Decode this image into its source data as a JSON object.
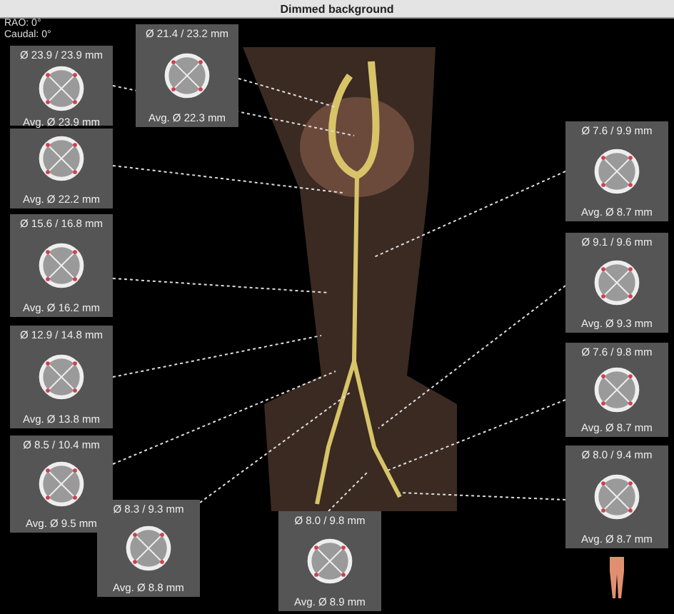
{
  "window": {
    "title": "Dimmed background"
  },
  "orientation": [
    "RAO: 0°",
    "Caudal: 0°"
  ],
  "panels": [
    {
      "diameters": "Ø 23.9 / 23.9 mm",
      "average": "Avg. Ø 23.9 mm"
    },
    {
      "average": "Avg. Ø 22.2 mm"
    },
    {
      "diameters": "Ø 15.6 / 16.8 mm",
      "average": "Avg. Ø 16.2 mm"
    },
    {
      "diameters": "Ø 12.9 / 14.8 mm",
      "average": "Avg. Ø 13.8 mm"
    },
    {
      "diameters": "Ø 8.5 / 10.4 mm",
      "average": "Avg. Ø 9.5 mm"
    },
    {
      "diameters": "Ø 8.3 / 9.3 mm",
      "average": "Avg. Ø 8.8 mm"
    },
    {
      "diameters": "Ø 21.4 / 23.2 mm",
      "average": "Avg. Ø 22.3 mm"
    },
    {
      "diameters": "Ø 8.0 / 9.8 mm",
      "average": "Avg. Ø 8.9 mm"
    },
    {
      "diameters": "Ø 7.6 / 9.9 mm",
      "average": "Avg. Ø 8.7 mm"
    },
    {
      "diameters": "Ø 9.1 / 9.6 mm",
      "average": "Avg. Ø 9.3 mm"
    },
    {
      "diameters": "Ø 7.6 / 9.8 mm",
      "average": "Avg. Ø 8.7 mm"
    },
    {
      "diameters": "Ø 8.0 / 9.4 mm",
      "average": "Avg. Ø 8.7 mm"
    }
  ]
}
